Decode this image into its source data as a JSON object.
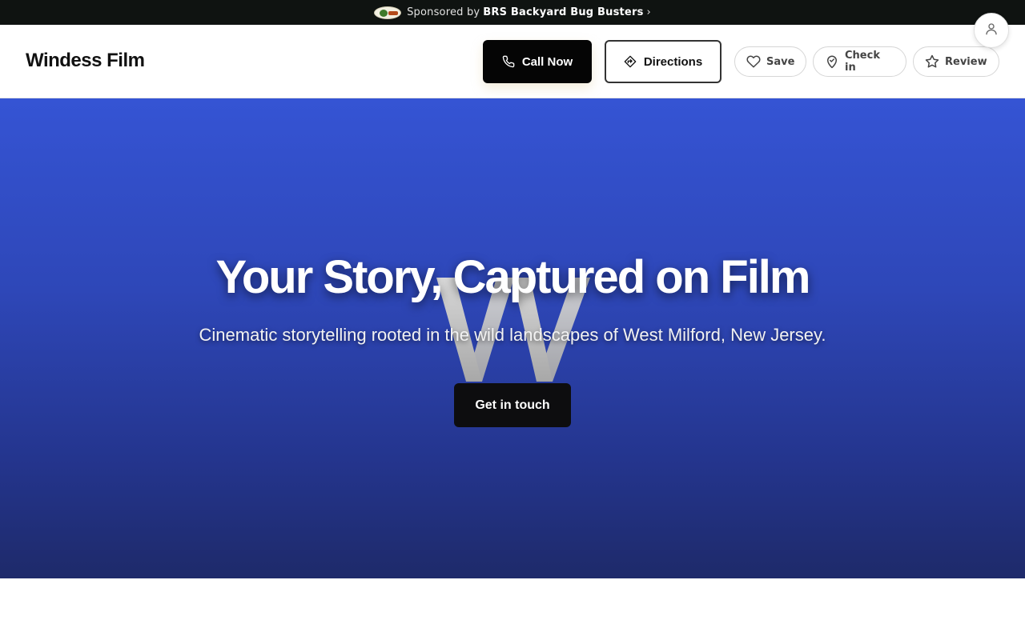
{
  "sponsor": {
    "prefix": "Sponsored by",
    "name": "BRS Backyard Bug Busters",
    "chevron": "›"
  },
  "header": {
    "brand": "Windess Film",
    "call_label": "Call Now",
    "directions_label": "Directions",
    "save_label": "Save",
    "checkin_label": "Check in",
    "review_label": "Review"
  },
  "hero": {
    "title": "Your Story, Captured on Film",
    "subtitle": "Cinematic storytelling rooted in the wild landscapes of West Milford, New Jersey.",
    "cta_label": "Get in touch"
  },
  "colors": {
    "sponsor_bg": "#0f1311",
    "hero_top": "#3554d4",
    "hero_bottom": "#1e2a6a",
    "primary_button": "#050505"
  },
  "icons": {
    "call": "phone-icon",
    "directions": "directions-icon",
    "save": "heart-icon",
    "checkin": "location-pin-icon",
    "review": "star-icon",
    "user": "user-icon"
  }
}
